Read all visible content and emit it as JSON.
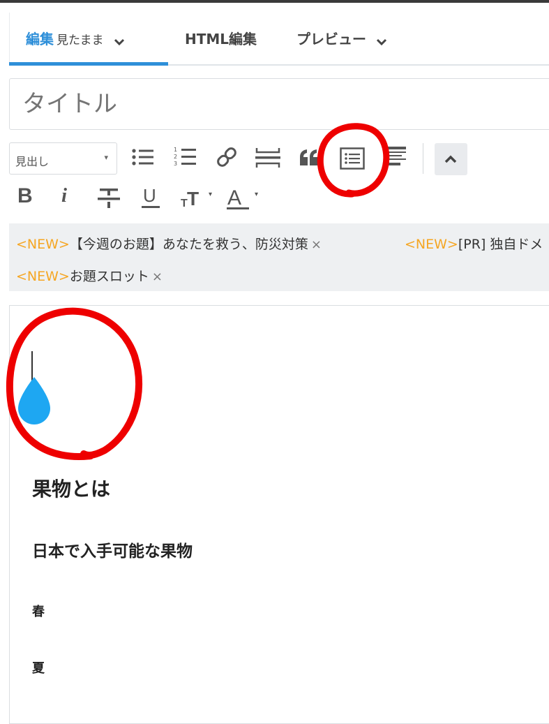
{
  "tabs": {
    "edit_label": "編集",
    "edit_mode": "見たまま",
    "html_label": "HTML編集",
    "preview_label": "プレビュー"
  },
  "title_input": {
    "placeholder": "タイトル"
  },
  "toolbar": {
    "heading_select_value": "見出し",
    "icons": [
      "unordered-list-icon",
      "ordered-list-icon",
      "link-icon",
      "horizontal-rule-icon",
      "blockquote-icon",
      "table-of-contents-icon",
      "more-list-icon",
      "collapse-toolbar-icon"
    ],
    "format_icons": [
      "bold-icon",
      "italic-icon",
      "strikethrough-icon",
      "underline-icon",
      "text-size-icon",
      "text-color-icon"
    ],
    "format_labels": {
      "bold": "B",
      "italic": "i",
      "underline": "U",
      "text_color": "A"
    }
  },
  "topics": [
    {
      "tag": "<NEW>",
      "text": "【今週のお題】あなたを救う、防災対策",
      "close": "×"
    },
    {
      "tag": "<NEW>",
      "text": "[PR] 独自ドメ",
      "close": ""
    },
    {
      "tag": "<NEW>",
      "text": "お題スロット",
      "close": "×"
    }
  ],
  "editor": {
    "h2": "果物とは",
    "h3": "日本で入手可能な果物",
    "h4_spring": "春",
    "h4_summer": "夏"
  },
  "colors": {
    "accent": "#2e8fd9",
    "new_tag": "#f5a623",
    "annotation": "#ee0000",
    "cursor_handle": "#1ea7f2"
  }
}
